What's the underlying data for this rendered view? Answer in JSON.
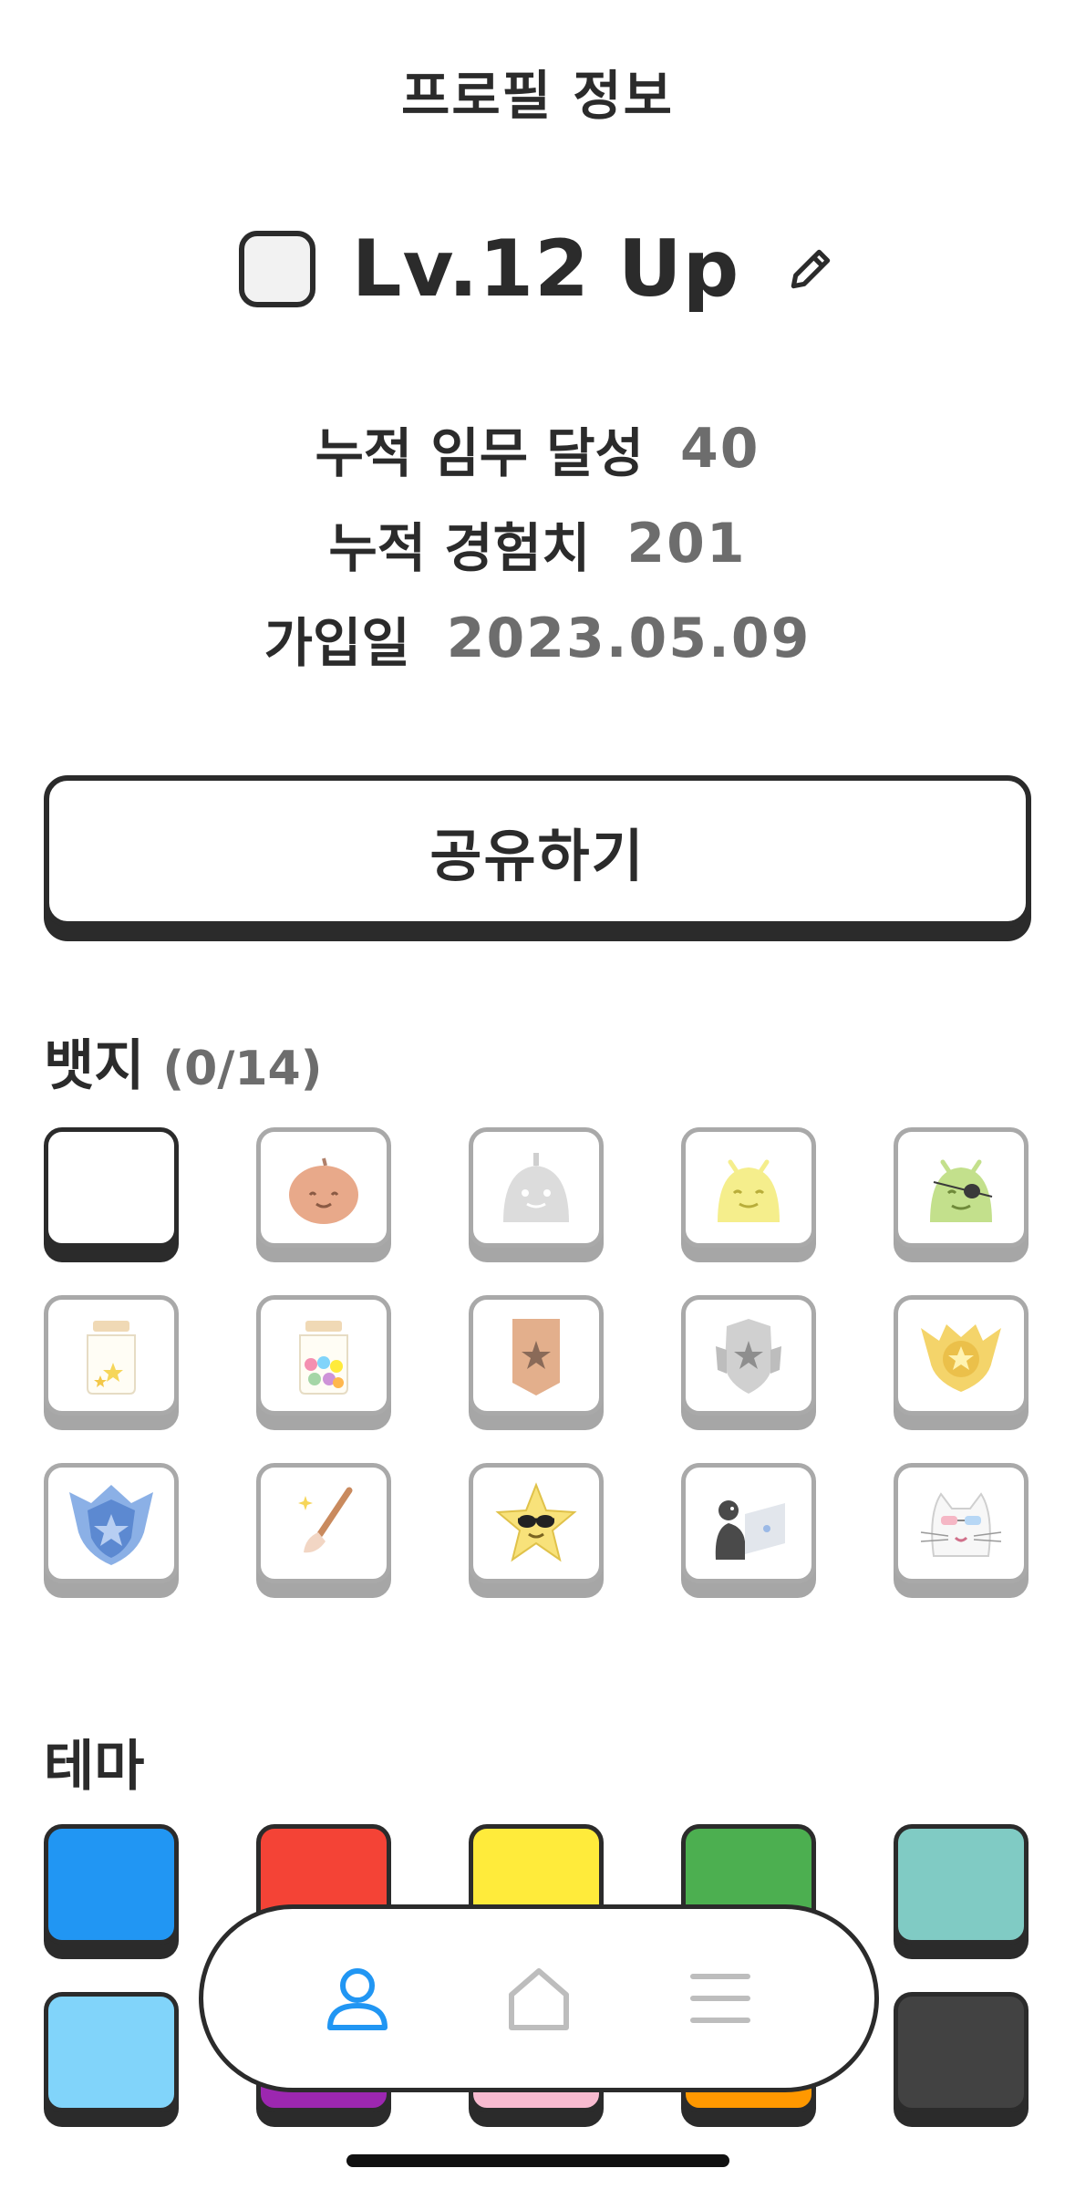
{
  "header": {
    "title": "프로필 정보"
  },
  "profile": {
    "level_text": "Lv.12 Up",
    "stats": [
      {
        "label": "누적 임무 달성",
        "value": "40"
      },
      {
        "label": "누적 경험치",
        "value": "201"
      },
      {
        "label": "가입일",
        "value": "2023.05.09"
      }
    ]
  },
  "share_button": {
    "label": "공유하기"
  },
  "badges": {
    "title": "뱃지",
    "count": "(0/14)",
    "items": [
      {
        "icon": "empty-slot"
      },
      {
        "icon": "pumpkin-face-icon",
        "color": "#E8A98A"
      },
      {
        "icon": "robot-face-icon",
        "color": "#DCDCDC"
      },
      {
        "icon": "android-yellow-icon",
        "color": "#F5EE8C"
      },
      {
        "icon": "android-pirate-icon",
        "color": "#C3E08C"
      },
      {
        "icon": "star-jar-small-icon",
        "color": "#F5E6B8"
      },
      {
        "icon": "star-jar-full-icon",
        "color": "#F5E6B8"
      },
      {
        "icon": "bronze-banner-icon",
        "color": "#E3AF8C"
      },
      {
        "icon": "silver-shield-icon",
        "color": "#D0D0D0"
      },
      {
        "icon": "gold-wings-icon",
        "color": "#F4D46A"
      },
      {
        "icon": "blue-crest-icon",
        "color": "#8BB0E6"
      },
      {
        "icon": "magic-brush-icon",
        "color": "#E9B99A"
      },
      {
        "icon": "cool-star-icon",
        "color": "#F8E27A"
      },
      {
        "icon": "laptop-coder-icon",
        "color": "#9AA0A8"
      },
      {
        "icon": "cool-cat-icon",
        "color": "#F0F0F0"
      }
    ]
  },
  "themes": {
    "title": "테마",
    "colors": [
      "#2196F3",
      "#F44336",
      "#FFEB3B",
      "#4CAF50",
      "#80CBC4",
      "#81D4FA",
      "#9C27B0",
      "#F8BBD0",
      "#FF9800",
      "#424242"
    ]
  },
  "bottom_nav": {
    "items": [
      {
        "icon": "person-icon",
        "active": true,
        "color": "#2196F3"
      },
      {
        "icon": "home-icon",
        "active": false,
        "color": "#BDBDBD"
      },
      {
        "icon": "menu-icon",
        "active": false,
        "color": "#BDBDBD"
      }
    ]
  }
}
